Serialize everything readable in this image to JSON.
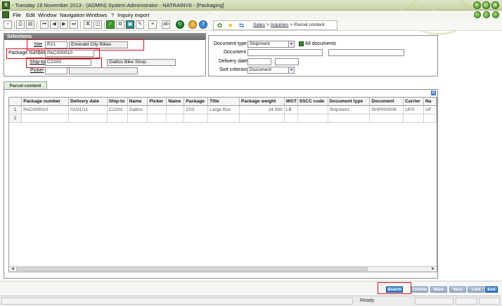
{
  "window": {
    "title": "- Tuesday 19 November 2013 - (ADMIN) System Administrator - NATRAINV6 - [Packaging]"
  },
  "menu": {
    "file": "File",
    "edit": "Edit",
    "window": "Window",
    "navigation": "Navigation",
    "windows": "Windows",
    "help": "?",
    "inquiry_export": "Inquiry export"
  },
  "breadcrumb": {
    "sales": "Sales",
    "sep1": ">",
    "inquiries": "Inquiries",
    "sep2": ">",
    "current": "Parcel content"
  },
  "selections": {
    "title": "Selections",
    "site_label": "Site",
    "site_code": "P21",
    "site_name": "Emerald City Bikes",
    "package_label": "Package number",
    "package_value": "PAC000010",
    "shipto_label": "Ship-to",
    "shipto_code": "C2203",
    "shipto_name": "Gattos Bike Shop",
    "picker_label": "Picker",
    "picker_value": "",
    "picker_desc": ""
  },
  "criteria": {
    "doctype_label": "Document type",
    "doctype_value": "Shipment",
    "all_documents_label": "All documents",
    "document_label": "Document",
    "document_value": "",
    "document_desc": "",
    "delivery_date_label": "Delivery date",
    "delivery_from": "",
    "delivery_to": "",
    "sort_label": "Sort criterion",
    "sort_value": "Document"
  },
  "tab": {
    "label": "Parcel content"
  },
  "grid": {
    "columns": [
      "Package number",
      "Delivery date",
      "Ship-to",
      "Name",
      "Picker",
      "Name",
      "Package",
      "Title",
      "Package weight",
      "WGT",
      "SSCC code",
      "Document type",
      "Document",
      "Carrier",
      "Na"
    ],
    "rows": [
      {
        "num": "1",
        "cells": [
          "PAC000010",
          "01/31/11",
          "C2203",
          "Gattos",
          "",
          "",
          "C03",
          "Large Box",
          "24.000",
          "LB",
          "",
          "Shipment",
          "SHP000006",
          "UPS",
          "UF"
        ]
      },
      {
        "num": "2",
        "cells": [
          "",
          "",
          "",
          "",
          "",
          "",
          "",
          "",
          "",
          "",
          "",
          "",
          "",
          "",
          ""
        ]
      }
    ]
  },
  "footer": {
    "search": "Search",
    "criteria": "Criteria",
    "back": "Back",
    "next": "Next",
    "last": "Last",
    "end": "End"
  },
  "status": {
    "text": "Ready"
  },
  "colors": {
    "highlight": "#d6121c",
    "active_button": "#2d78c9",
    "panel_title": "#6a6a6a"
  }
}
